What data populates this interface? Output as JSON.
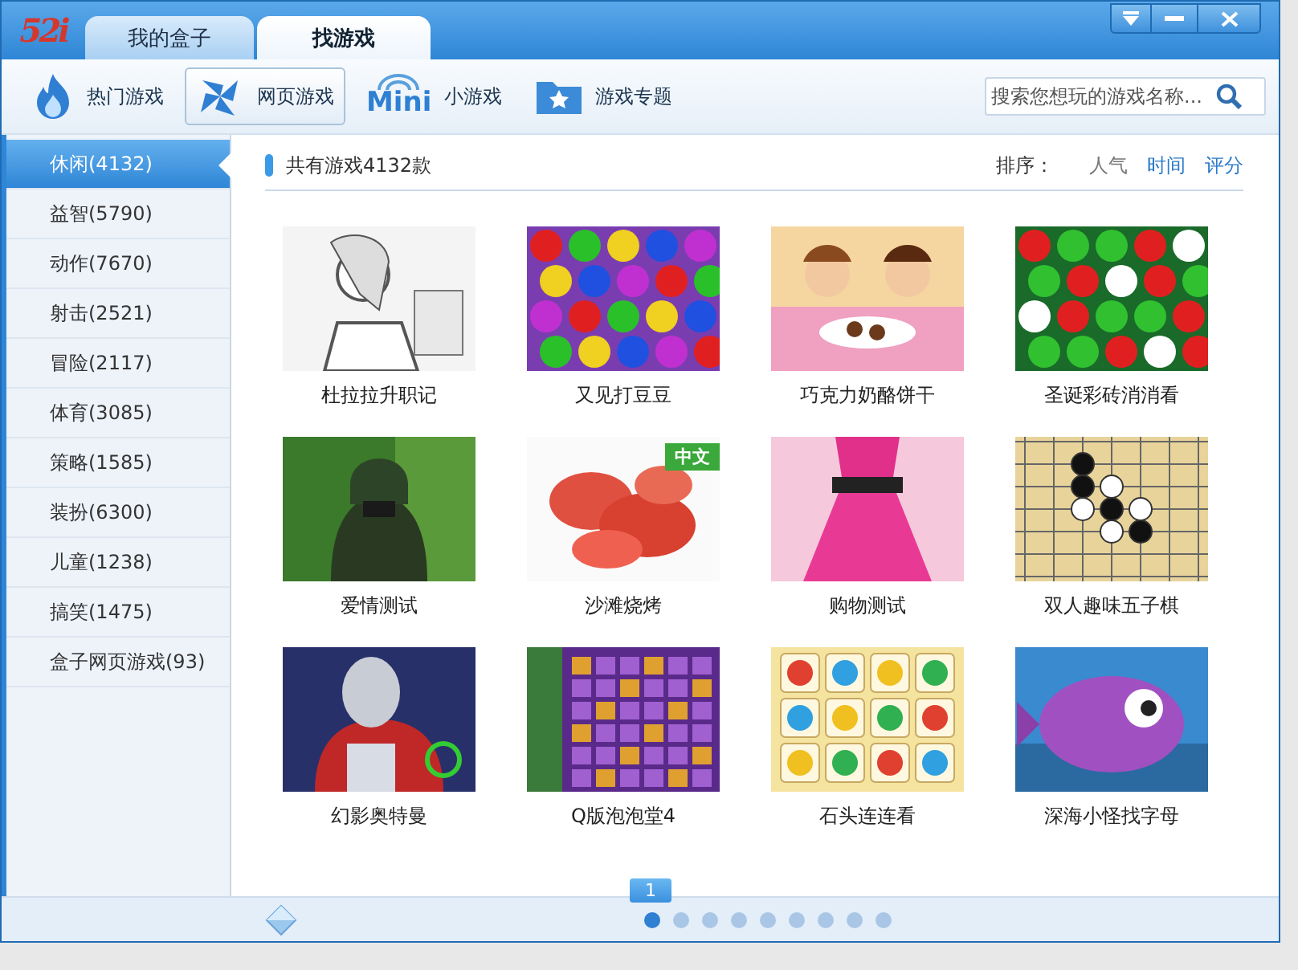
{
  "window": {
    "logo": "52i",
    "tabs": [
      {
        "label": "我的盒子",
        "selected": false
      },
      {
        "label": "找游戏",
        "selected": true
      }
    ]
  },
  "toolbar": {
    "items": [
      {
        "label": "热门游戏",
        "selected": false
      },
      {
        "label": "网页游戏",
        "selected": true
      },
      {
        "label": "小游戏",
        "icon_text": "Mini",
        "selected": false
      },
      {
        "label": "游戏专题",
        "selected": false
      }
    ],
    "search": {
      "placeholder": "搜索您想玩的游戏名称..."
    }
  },
  "categories": [
    {
      "label": "休闲(4132)",
      "selected": true
    },
    {
      "label": "益智(5790)",
      "selected": false
    },
    {
      "label": "动作(7670)",
      "selected": false
    },
    {
      "label": "射击(2521)",
      "selected": false
    },
    {
      "label": "冒险(2117)",
      "selected": false
    },
    {
      "label": "体育(3085)",
      "selected": false
    },
    {
      "label": "策略(1585)",
      "selected": false
    },
    {
      "label": "装扮(6300)",
      "selected": false
    },
    {
      "label": "儿童(1238)",
      "selected": false
    },
    {
      "label": "搞笑(1475)",
      "selected": false
    },
    {
      "label": "盒子网页游戏(93)",
      "selected": false
    }
  ],
  "content": {
    "total": "共有游戏4132款",
    "sort_label": "排序：",
    "sort_options": [
      {
        "label": "人气",
        "selected": true
      },
      {
        "label": "时间",
        "selected": false
      },
      {
        "label": "评分",
        "selected": false
      }
    ]
  },
  "games": [
    {
      "title": "杜拉拉升职记",
      "kind": "picture"
    },
    {
      "title": "又见打豆豆",
      "kind": "picture"
    },
    {
      "title": "巧克力奶酪饼干",
      "kind": "picture"
    },
    {
      "title": "圣诞彩砖消消看",
      "kind": "picture"
    },
    {
      "title": "爱情测试",
      "kind": "picture"
    },
    {
      "title": "沙滩烧烤",
      "kind": "picture",
      "badge": "中文"
    },
    {
      "title": "购物测试",
      "kind": "picture"
    },
    {
      "title": "双人趣味五子棋",
      "kind": "picture"
    },
    {
      "title": "幻影奥特曼",
      "kind": "picture"
    },
    {
      "title": "Q版泡泡堂4",
      "kind": "picture"
    },
    {
      "title": "石头连连看",
      "kind": "picture"
    },
    {
      "title": "深海小怪找字母",
      "kind": "picture"
    }
  ],
  "pager": {
    "current_label": "1",
    "dots": [
      {
        "selected": true
      },
      {
        "selected": false
      },
      {
        "selected": false
      },
      {
        "selected": false
      },
      {
        "selected": false
      },
      {
        "selected": false
      },
      {
        "selected": false
      },
      {
        "selected": false
      },
      {
        "selected": false
      }
    ]
  }
}
